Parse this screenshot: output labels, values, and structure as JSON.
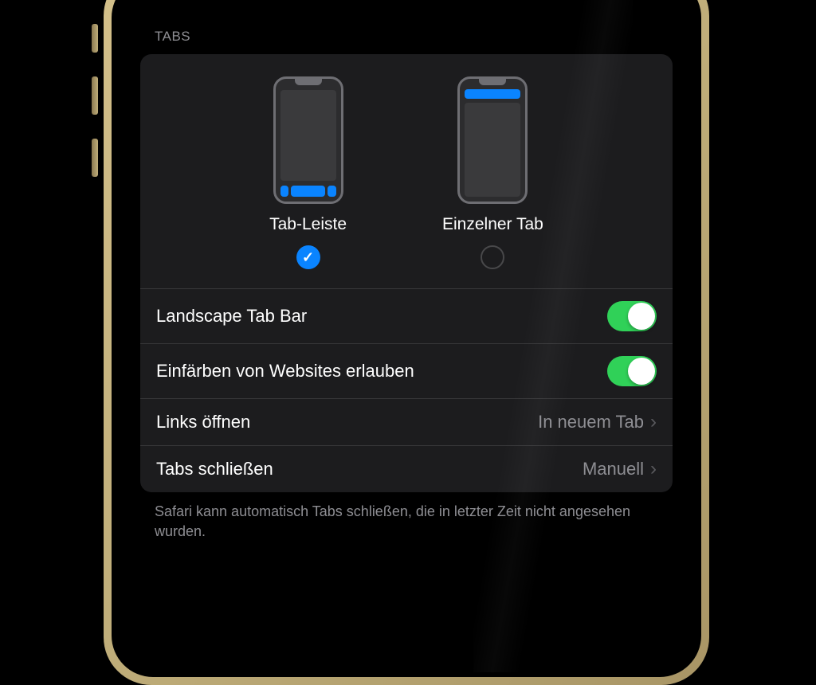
{
  "section_header": "TABS",
  "layout_options": {
    "tab_leiste": {
      "label": "Tab-Leiste",
      "selected": true
    },
    "einzelner_tab": {
      "label": "Einzelner Tab",
      "selected": false
    }
  },
  "settings": {
    "landscape_tab_bar": {
      "label": "Landscape Tab Bar",
      "enabled": true
    },
    "einfaerben": {
      "label": "Einfärben von Websites erlauben",
      "enabled": true
    },
    "links_oeffnen": {
      "label": "Links öffnen",
      "value": "In neuem Tab"
    },
    "tabs_schliessen": {
      "label": "Tabs schließen",
      "value": "Manuell"
    }
  },
  "footer_text": "Safari kann automatisch Tabs schließen, die in letzter Zeit nicht angesehen wurden."
}
